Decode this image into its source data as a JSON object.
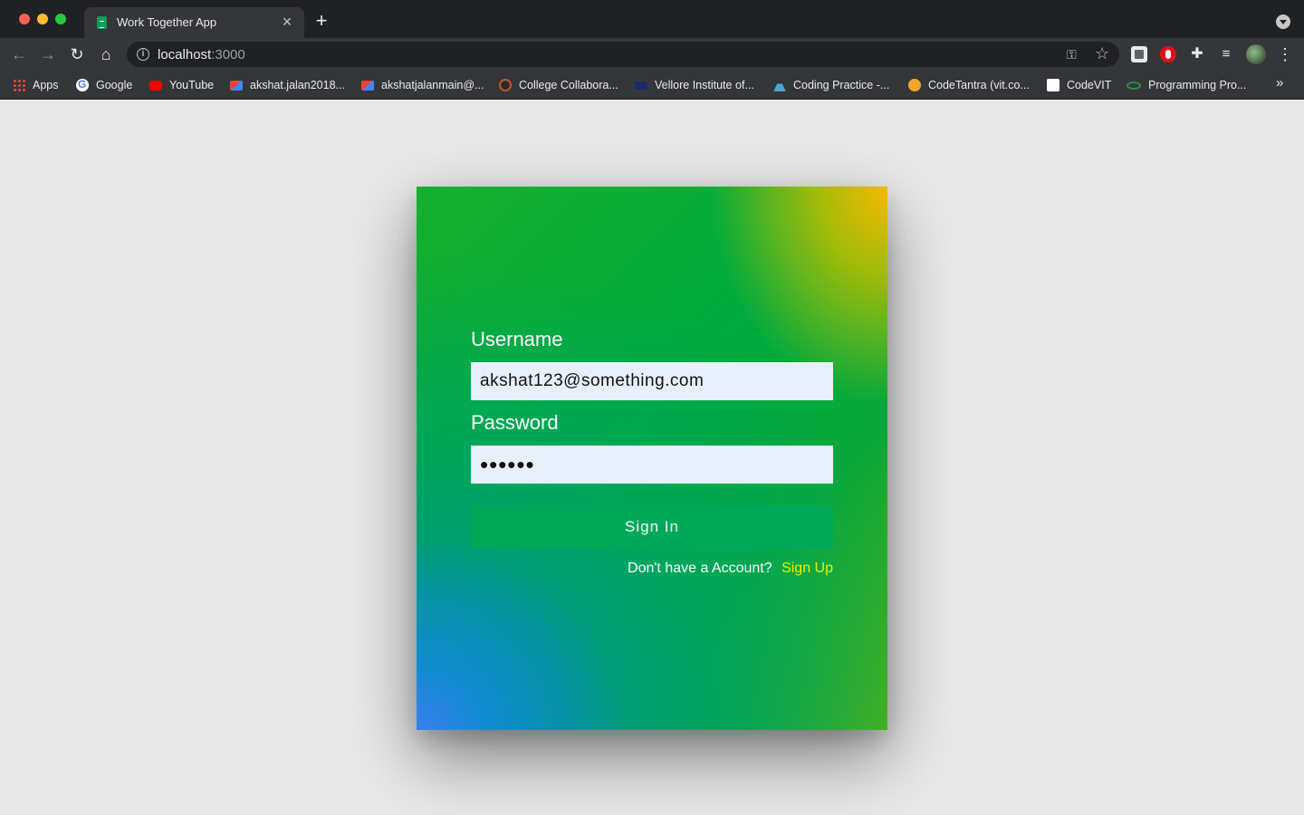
{
  "browser": {
    "tab": {
      "title": "Work Together App",
      "close_glyph": "×"
    },
    "new_tab_glyph": "+",
    "toolbar": {
      "back_glyph": "←",
      "forward_glyph": "→",
      "reload_glyph": "↻",
      "home_glyph": "⌂",
      "info_glyph": "i",
      "url_host": "localhost",
      "url_port": ":3000",
      "key_glyph": "⚿",
      "star_glyph": "☆",
      "puzzle_glyph": "✚",
      "media_glyph": "≡",
      "menu_glyph": "⋮"
    },
    "bookmarks": [
      {
        "label": "Apps",
        "icon": "apps-grid-icon"
      },
      {
        "label": "Google",
        "icon": "google-icon"
      },
      {
        "label": "YouTube",
        "icon": "youtube-icon"
      },
      {
        "label": "akshat.jalan2018...",
        "icon": "gmail-icon"
      },
      {
        "label": "akshatjalanmain@...",
        "icon": "gmail-icon"
      },
      {
        "label": "College Collabora...",
        "icon": "college-collab-icon"
      },
      {
        "label": "Vellore Institute of...",
        "icon": "vit-icon"
      },
      {
        "label": "Coding Practice -...",
        "icon": "coding-practice-icon"
      },
      {
        "label": "CodeTantra (vit.co...",
        "icon": "codetantra-icon"
      },
      {
        "label": "CodeVIT",
        "icon": "codevit-icon"
      },
      {
        "label": "Programming Pro...",
        "icon": "gfg-icon"
      }
    ],
    "bookmarks_more_glyph": "»"
  },
  "login": {
    "username_label": "Username",
    "username_value": "akshat123@something.com",
    "password_label": "Password",
    "password_value": "••••••",
    "signin_label": "Sign In",
    "no_account_text": "Don't have a Account?",
    "signup_label": "Sign Up"
  },
  "colors": {
    "page_bg": "#e8e8e8",
    "input_bg": "#e8f0fe",
    "button_bg": "#00a859",
    "signup_link": "#e6f200"
  }
}
